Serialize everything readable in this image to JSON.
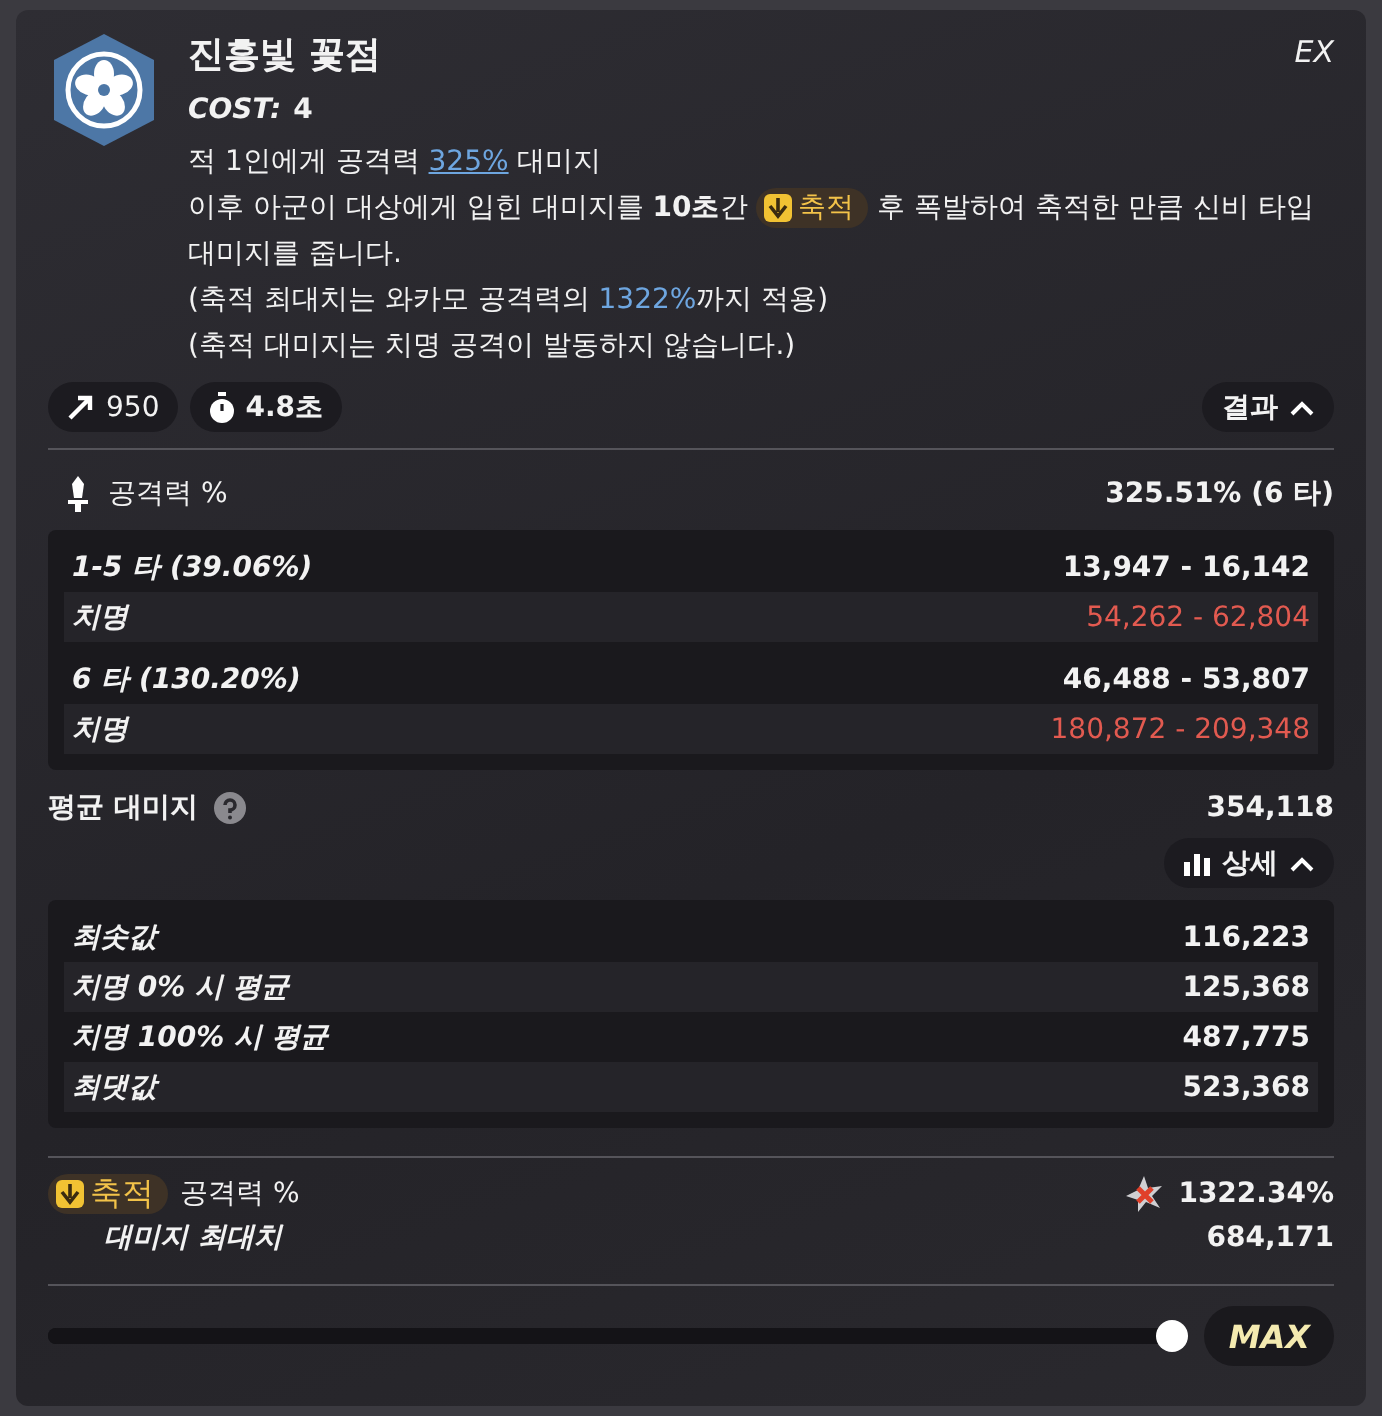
{
  "skill": {
    "name": "진흥빛 꽃점",
    "type": "EX",
    "cost_label": "COST:",
    "cost": "4",
    "description": [
      [
        {
          "kind": "text",
          "text": "적 1인에게 공격력 "
        },
        {
          "kind": "link",
          "text": "325%"
        },
        {
          "kind": "text",
          "text": " 대미지"
        }
      ],
      [
        {
          "kind": "text",
          "text": "이후 아군이 대상에게 입힌 대미지를 "
        },
        {
          "kind": "bold",
          "text": "10초"
        },
        {
          "kind": "text",
          "text": "간 "
        },
        {
          "kind": "tag",
          "text": "축적"
        },
        {
          "kind": "text",
          "text": " 후 폭발하여 축적한 만큼 신비 타입 대미지를 줍니다."
        }
      ],
      [
        {
          "kind": "text",
          "text": "(축적 최대치는 와카모 공격력의 "
        },
        {
          "kind": "highlight",
          "text": "1322%"
        },
        {
          "kind": "text",
          "text": "까지 적용)"
        }
      ],
      [
        {
          "kind": "text",
          "text": "(축적 대미지는 치명 공격이 발동하지 않습니다.)"
        }
      ]
    ]
  },
  "chips": [
    {
      "kind": "range",
      "value": "950"
    },
    {
      "kind": "time",
      "value": "4.8초"
    }
  ],
  "result_toggle": {
    "label": "결과",
    "expanded": true
  },
  "attack": {
    "label": "공격력 %",
    "value": "325.51% (6 타)"
  },
  "hits": [
    {
      "label": "1-5 타 (39.06%)",
      "value": "13,947 - 16,142",
      "crit_label": "치명",
      "crit_value": "54,262 - 62,804"
    },
    {
      "label": "6 타 (130.20%)",
      "value": "46,488 - 53,807",
      "crit_label": "치명",
      "crit_value": "180,872 - 209,348"
    }
  ],
  "average": {
    "label": "평균 대미지",
    "value": "354,118"
  },
  "detail_toggle": {
    "label": "상세",
    "expanded": true
  },
  "summary": [
    {
      "label": "최솟값",
      "value": "116,223"
    },
    {
      "label": "치명 0% 시 평균",
      "value": "125,368"
    },
    {
      "label": "치명 100% 시 평균",
      "value": "487,775"
    },
    {
      "label": "최댓값",
      "value": "523,368"
    }
  ],
  "accumulate": {
    "tag": "축적",
    "label": "공격력 %",
    "value": "1322.34%",
    "sub_label": "대미지 최대치",
    "sub_value": "684,171"
  },
  "slider": {
    "level": 1,
    "label": "MAX"
  }
}
